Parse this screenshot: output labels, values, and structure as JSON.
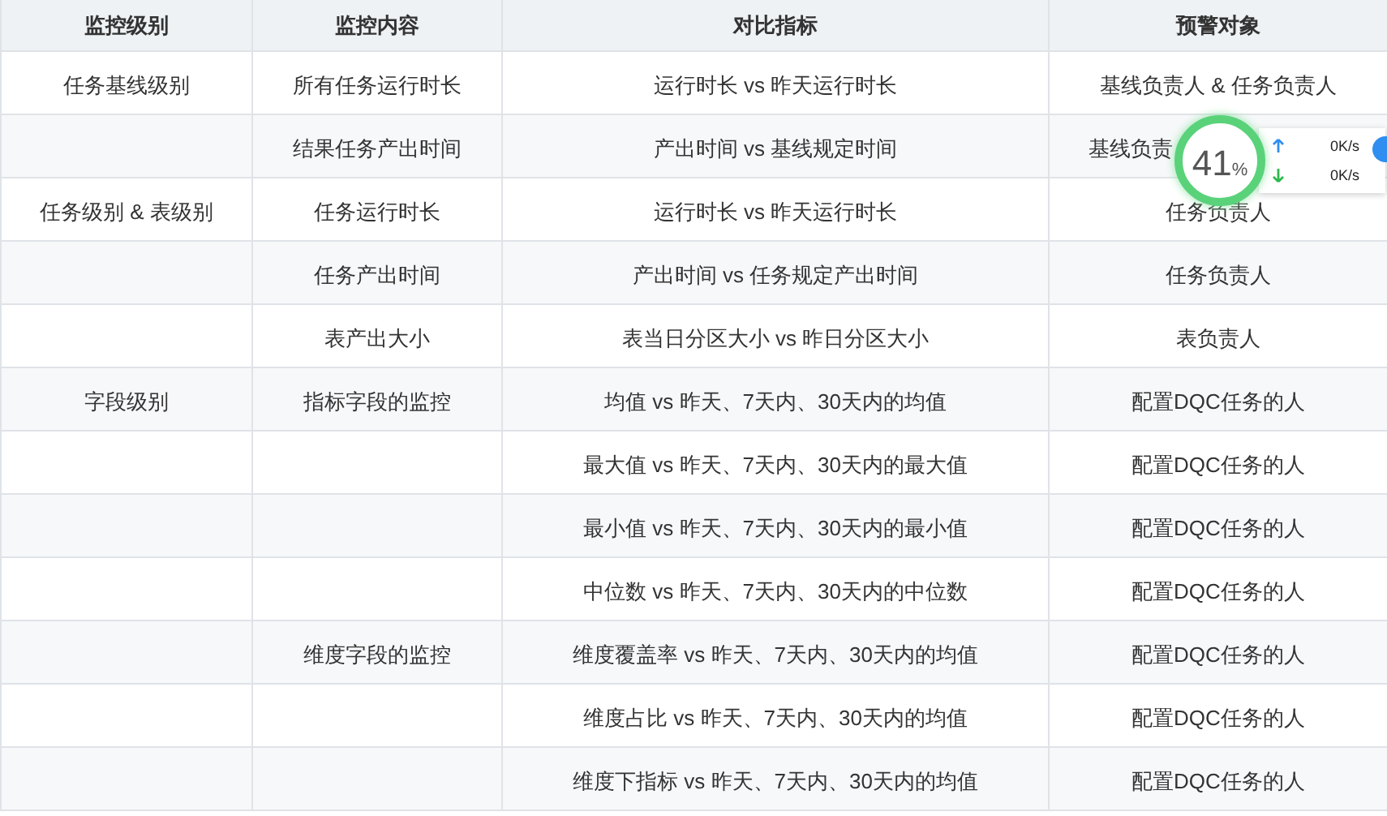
{
  "table": {
    "columns": [
      "监控级别",
      "监控内容",
      "对比指标",
      "预警对象"
    ],
    "rows": [
      {
        "level": "任务基线级别",
        "content": "所有任务运行时长",
        "metric": "运行时长 vs 昨天运行时长",
        "target": "基线负责人 & 任务负责人"
      },
      {
        "content": "结果任务产出时间",
        "metric": "产出时间 vs 基线规定时间",
        "target": "基线负责",
        "target_covered": true
      },
      {
        "level": "任务级别 & 表级别",
        "content": "任务运行时长",
        "metric": "运行时长 vs 昨天运行时长",
        "target": "任务负责人"
      },
      {
        "content": "任务产出时间",
        "metric": "产出时间 vs 任务规定产出时间",
        "target": "任务负责人"
      },
      {
        "content": "表产出大小",
        "metric": "表当日分区大小 vs 昨日分区大小",
        "target": "表负责人"
      },
      {
        "level": "字段级别",
        "content": "指标字段的监控",
        "metric": "均值 vs 昨天、7天内、30天内的均值",
        "target": "配置DQC任务的人"
      },
      {
        "metric": "最大值 vs 昨天、7天内、30天内的最大值",
        "target": "配置DQC任务的人"
      },
      {
        "metric": "最小值 vs 昨天、7天内、30天内的最小值",
        "target": "配置DQC任务的人"
      },
      {
        "metric": "中位数 vs 昨天、7天内、30天内的中位数",
        "target": "配置DQC任务的人"
      },
      {
        "content": "维度字段的监控",
        "metric": "维度覆盖率 vs 昨天、7天内、30天内的均值",
        "target": "配置DQC任务的人"
      },
      {
        "metric": "维度占比 vs 昨天、7天内、30天内的均值",
        "target": "配置DQC任务的人"
      },
      {
        "metric": "维度下指标 vs 昨天、7天内、30天内的均值",
        "target": "配置DQC任务的人"
      }
    ]
  },
  "speed_widget": {
    "percent": "41",
    "unit": "%",
    "upload": "0K/s",
    "download": "0K/s"
  }
}
